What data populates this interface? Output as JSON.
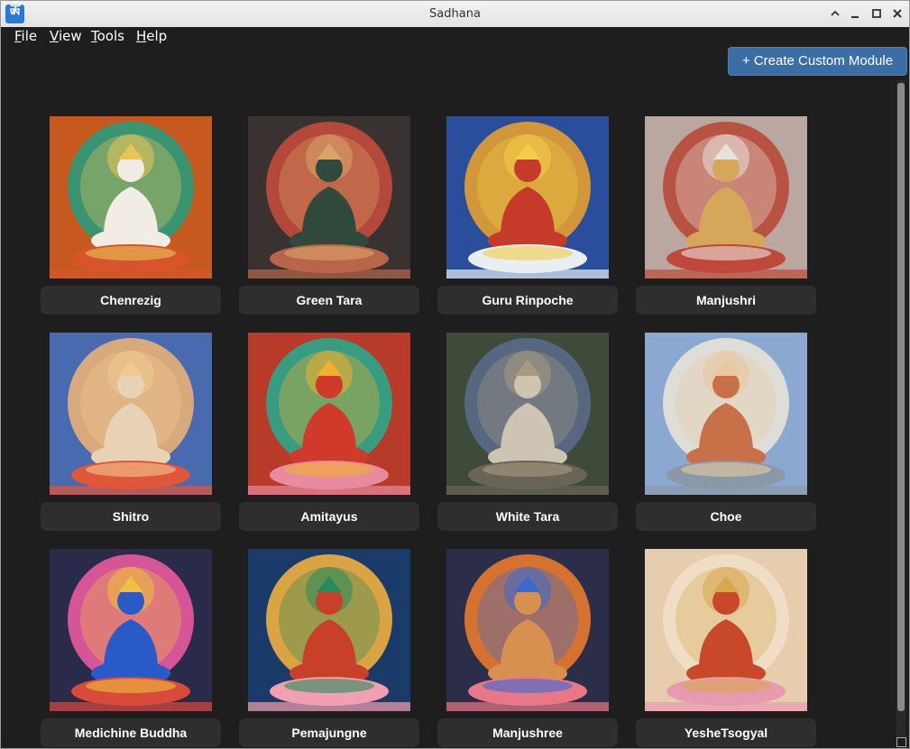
{
  "window": {
    "title": "Sadhana",
    "app_icon_glyph": "ༀ"
  },
  "menu": [
    {
      "mnemonic": "F",
      "rest": "ile"
    },
    {
      "mnemonic": "V",
      "rest": "iew"
    },
    {
      "mnemonic": "T",
      "rest": "ools"
    },
    {
      "mnemonic": "H",
      "rest": "elp"
    }
  ],
  "toolbar": {
    "create_label": "+ Create Custom Module"
  },
  "modules": [
    {
      "label": "Chenrezig",
      "colors": {
        "bg": "#c65a1e",
        "halo": "#2b9a7a",
        "body": "#f1ede4",
        "base": "#d8542a",
        "accent": "#e8c45a"
      }
    },
    {
      "label": "Green Tara",
      "colors": {
        "bg": "#3a3230",
        "halo": "#c24a3c",
        "body": "#2f4a3a",
        "base": "#b8654a",
        "accent": "#d9a46a"
      }
    },
    {
      "label": "Guru Rinpoche",
      "colors": {
        "bg": "#2b4e9c",
        "halo": "#e4a030",
        "body": "#c63a2a",
        "base": "#e8eef2",
        "accent": "#f2cc4a"
      }
    },
    {
      "label": "Manjushri",
      "colors": {
        "bg": "#b9a7a0",
        "halo": "#b84a3a",
        "body": "#d6a65a",
        "base": "#c0483a",
        "accent": "#e9e2da"
      }
    },
    {
      "label": "Shitro",
      "colors": {
        "bg": "#4a6ab0",
        "halo": "#e8b078",
        "body": "#e8d2b6",
        "base": "#e0563a",
        "accent": "#f0c890"
      }
    },
    {
      "label": "Amitayus",
      "colors": {
        "bg": "#b83a28",
        "halo": "#2aa88a",
        "body": "#d03a2a",
        "base": "#e88aa0",
        "accent": "#f0b030"
      }
    },
    {
      "label": "White Tara",
      "colors": {
        "bg": "#3e4a3a",
        "halo": "#5a6a88",
        "body": "#cdc4b4",
        "base": "#6a6458",
        "accent": "#a89a80"
      }
    },
    {
      "label": "Choe",
      "colors": {
        "bg": "#8aa8d0",
        "halo": "#e8e2d8",
        "body": "#c87048",
        "base": "#8a98a8",
        "accent": "#e8c8a0"
      }
    },
    {
      "label": "Medichine Buddha",
      "colors": {
        "bg": "#2a2a4a",
        "halo": "#e85aa0",
        "body": "#2a5ac8",
        "base": "#d84a3a",
        "accent": "#f0c040"
      }
    },
    {
      "label": "Pemajungne",
      "colors": {
        "bg": "#1a3a6a",
        "halo": "#f0b040",
        "body": "#c8402a",
        "base": "#f0a0b0",
        "accent": "#2a8a5a"
      }
    },
    {
      "label": "Manjushree",
      "colors": {
        "bg": "#2a2e48",
        "halo": "#e87a30",
        "body": "#d89050",
        "base": "#e87888",
        "accent": "#3a6ad0"
      }
    },
    {
      "label": "YesheTsogyal",
      "colors": {
        "bg": "#e8ccae",
        "halo": "#f0e0c8",
        "body": "#c8482a",
        "base": "#e89ab0",
        "accent": "#d8a850"
      }
    }
  ]
}
